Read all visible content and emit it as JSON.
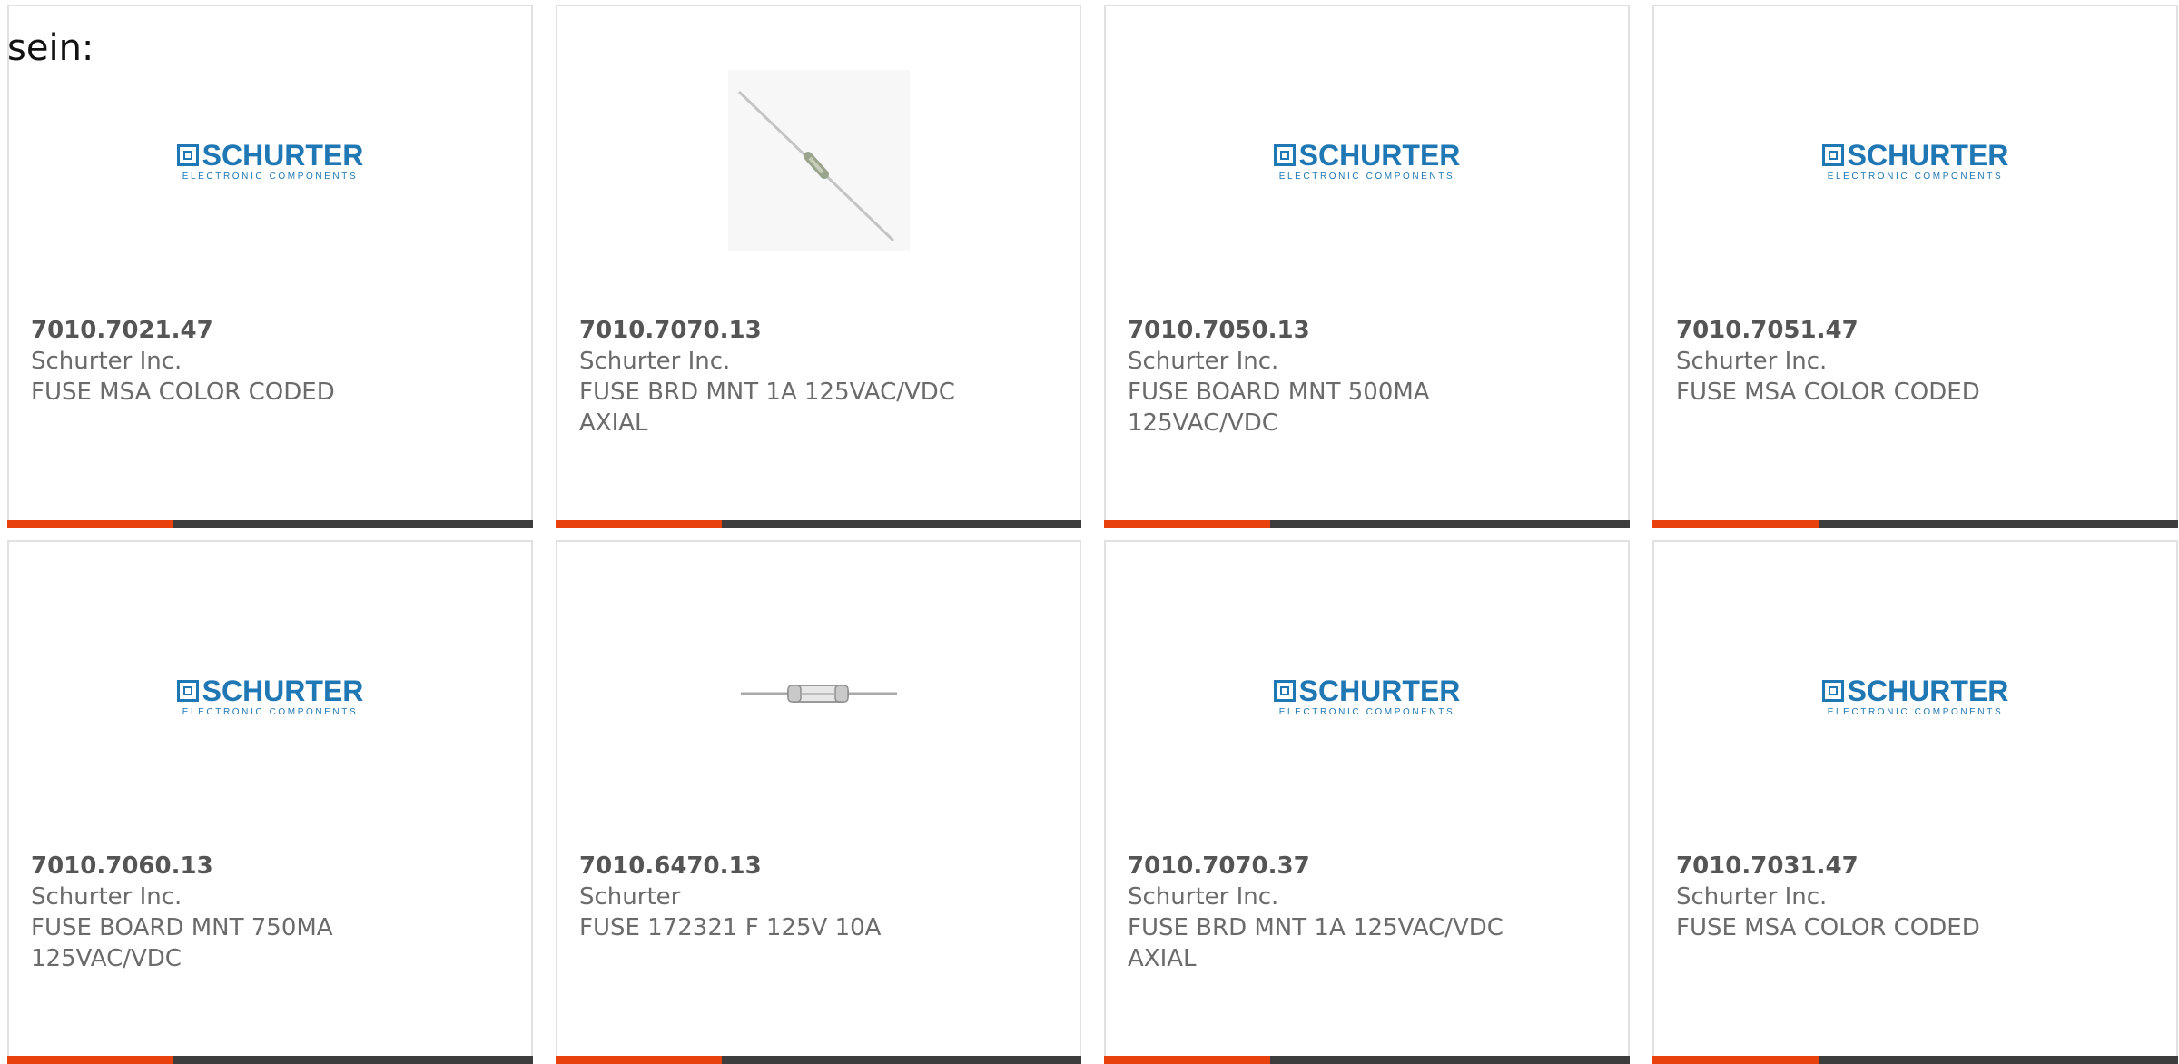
{
  "intro_text": "sein:",
  "colors": {
    "accent": "#e8410e",
    "bar": "#3d3d3d",
    "brand_blue": "#1f77b4",
    "card_border": "#e1e1e1"
  },
  "logo": {
    "name": "SCHURTER",
    "tagline": "ELECTRONIC COMPONENTS"
  },
  "products": [
    {
      "part": "7010.7021.47",
      "maker": "Schurter Inc.",
      "desc": "FUSE MSA COLOR CODED",
      "image": "schurter-logo"
    },
    {
      "part": "7010.7070.13",
      "maker": "Schurter Inc.",
      "desc": "FUSE BRD MNT 1A 125VAC/VDC AXIAL",
      "image": "axial-lead-fuse-photo"
    },
    {
      "part": "7010.7050.13",
      "maker": "Schurter Inc.",
      "desc": "FUSE BOARD MNT 500MA 125VAC/VDC",
      "image": "schurter-logo"
    },
    {
      "part": "7010.7051.47",
      "maker": "Schurter Inc.",
      "desc": "FUSE MSA COLOR CODED",
      "image": "schurter-logo"
    },
    {
      "part": "7010.7060.13",
      "maker": "Schurter Inc.",
      "desc": "FUSE BOARD MNT 750MA 125VAC/VDC",
      "image": "schurter-logo"
    },
    {
      "part": "7010.6470.13",
      "maker": "Schurter",
      "desc": "FUSE 172321 F 125V 10A",
      "image": "glass-fuse-photo"
    },
    {
      "part": "7010.7070.37",
      "maker": "Schurter Inc.",
      "desc": "FUSE BRD MNT 1A 125VAC/VDC AXIAL",
      "image": "schurter-logo"
    },
    {
      "part": "7010.7031.47",
      "maker": "Schurter Inc.",
      "desc": "FUSE MSA COLOR CODED",
      "image": "schurter-logo"
    }
  ]
}
